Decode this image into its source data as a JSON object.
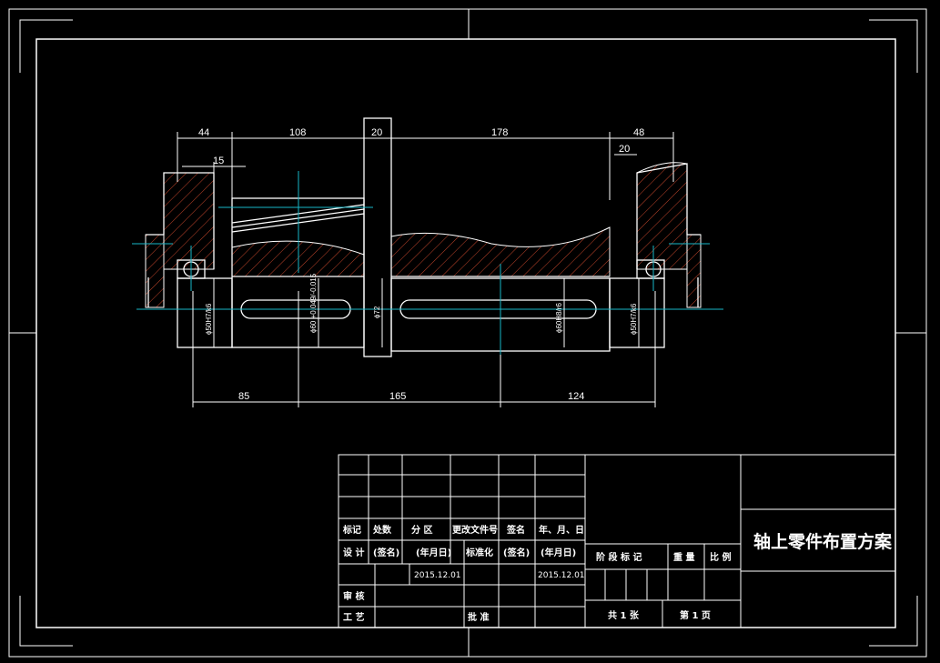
{
  "dimensions": {
    "top": [
      "44",
      "108",
      "20",
      "178",
      "48"
    ],
    "sub": [
      "15",
      "20"
    ],
    "bottom": [
      "85",
      "165",
      "124"
    ],
    "diameters": [
      "ϕ50H7/k6",
      "ϕ60 +0.049/-0.015",
      "ϕ72",
      "ϕ60H8/r6",
      "ϕ50H7/k6"
    ]
  },
  "title_block": {
    "title": "轴上零件布置方案",
    "headers": [
      "标记",
      "处数",
      "分 区",
      "更改文件号",
      "签名",
      "年、月、日"
    ],
    "design_row": [
      "设 计",
      "(签名)",
      "(年月日)",
      "标准化",
      "(签名)",
      "(年月日)"
    ],
    "dates": [
      "2015.12.01",
      "2015.12.01"
    ],
    "review": "审 核",
    "process": "工 艺",
    "approve": "批 准",
    "stage_labels": [
      "阶 段 标 记",
      "重 量",
      "比 例"
    ],
    "sheet_info": [
      "共 1 张",
      "第 1 页"
    ]
  }
}
